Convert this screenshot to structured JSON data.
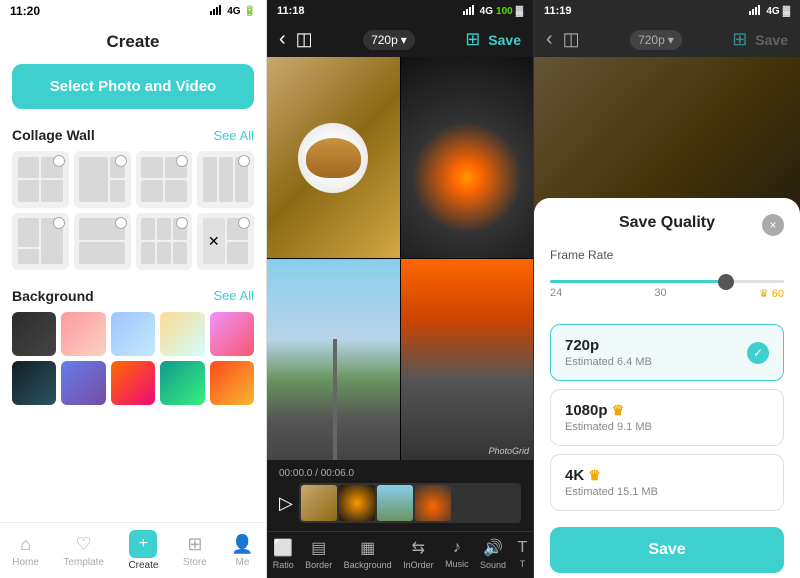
{
  "panel1": {
    "status_time": "11:20",
    "title": "Create",
    "select_btn": "Select Photo and Video",
    "collage_section": "Collage Wall",
    "see_all_1": "See All",
    "background_section": "Background",
    "see_all_2": "See All",
    "nav": {
      "home": "Home",
      "template": "Template",
      "create": "Create",
      "store": "Store",
      "me": "Me"
    }
  },
  "panel2": {
    "status_time": "11:18",
    "resolution": "720p",
    "save_label": "Save",
    "timeline_time": "00:00.0 / 00:06.0",
    "tools": [
      "Ratio",
      "Border",
      "Background",
      "InOrder",
      "Music",
      "Sound",
      "T"
    ],
    "watermark": "PhotoGrid"
  },
  "panel3": {
    "status_time": "11:19",
    "resolution": "720p",
    "save_label": "Save",
    "modal": {
      "title": "Save Quality",
      "close": "×",
      "frame_rate_label": "Frame Rate",
      "slider_min": "24",
      "slider_mid": "30",
      "slider_max": "60",
      "options": [
        {
          "name": "720p",
          "size": "Estimated 6.4 MB",
          "selected": true,
          "crown": false
        },
        {
          "name": "1080p",
          "size": "Estimated 9.1 MB",
          "selected": false,
          "crown": true
        },
        {
          "name": "4K",
          "size": "Estimated 15.1 MB",
          "selected": false,
          "crown": true
        }
      ],
      "save_btn": "Save"
    }
  }
}
